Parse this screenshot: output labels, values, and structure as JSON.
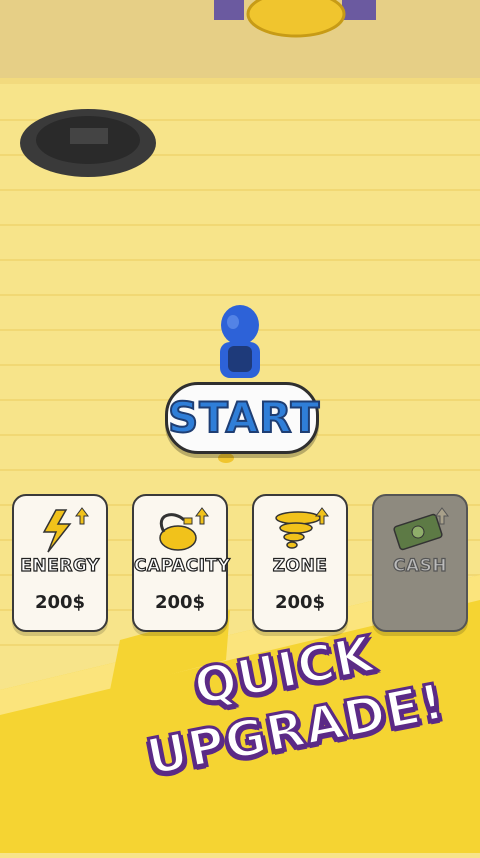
{
  "game": {
    "start_label": "START",
    "upgrades": [
      {
        "label": "ENERGY",
        "price": "200$"
      },
      {
        "label": "CAPACITY",
        "price": "200$"
      },
      {
        "label": "ZONE",
        "price": "200$"
      },
      {
        "label": "CASH",
        "price": ""
      }
    ],
    "promo": {
      "line1": "QUICK",
      "line2": "UPGRADE!"
    }
  },
  "colors": {
    "floor": "#f7e48a",
    "wall": "#e6cf86",
    "promo_outline": "#5b2a86",
    "start_text": "#2f7ed8"
  }
}
